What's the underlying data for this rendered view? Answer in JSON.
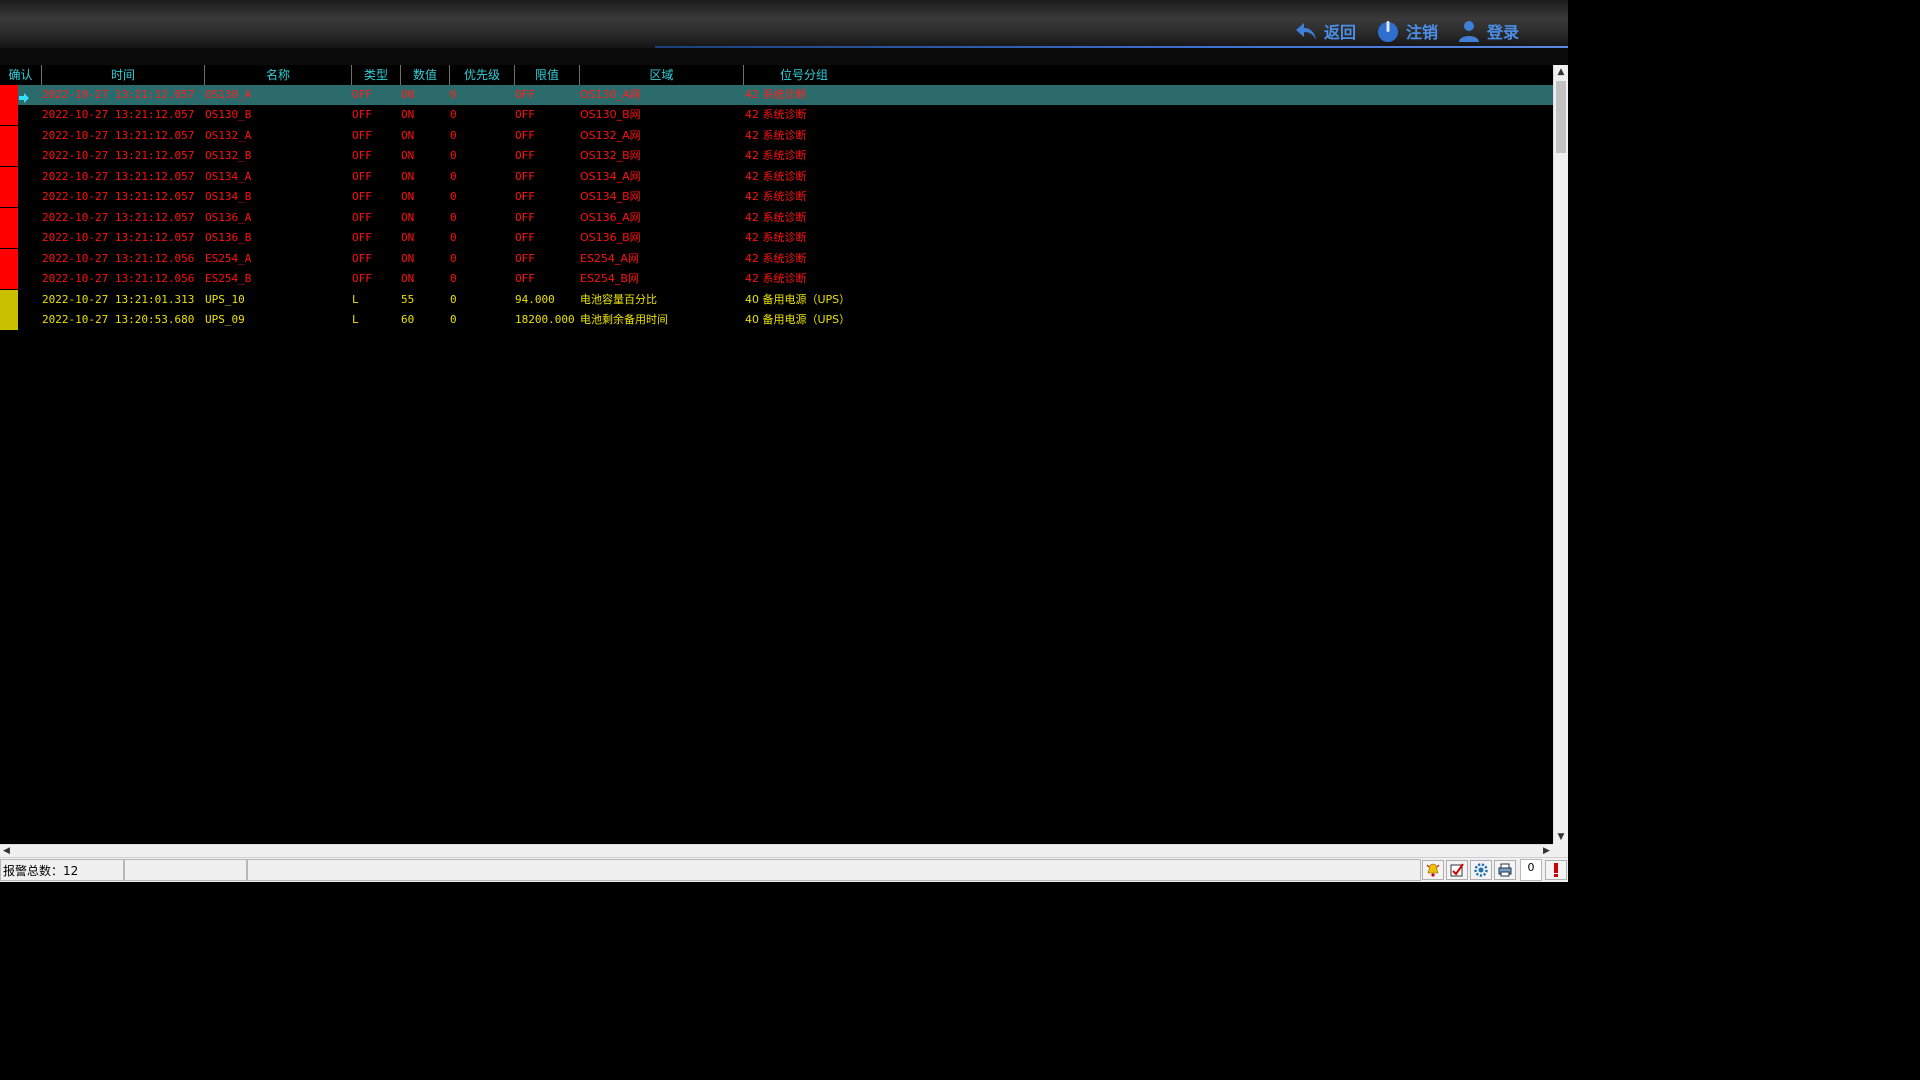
{
  "header": {
    "back_label": "返回",
    "logout_label": "注销",
    "login_label": "登录"
  },
  "table": {
    "columns": [
      "确认",
      "时间",
      "名称",
      "类型",
      "数值",
      "优先级",
      "限值",
      "区域",
      "位号分组"
    ],
    "rows": [
      {
        "color": "red",
        "selected": true,
        "time": "2022-10-27 13:21:12.057",
        "name": "OS130_A",
        "type": "OFF",
        "value": "ON",
        "priority": "0",
        "limit": "OFF",
        "area": "OS130_A网",
        "group": "42 系统诊断"
      },
      {
        "color": "red",
        "selected": false,
        "time": "2022-10-27 13:21:12.057",
        "name": "OS130_B",
        "type": "OFF",
        "value": "ON",
        "priority": "0",
        "limit": "OFF",
        "area": "OS130_B网",
        "group": "42 系统诊断"
      },
      {
        "color": "red",
        "selected": false,
        "time": "2022-10-27 13:21:12.057",
        "name": "OS132_A",
        "type": "OFF",
        "value": "ON",
        "priority": "0",
        "limit": "OFF",
        "area": "OS132_A网",
        "group": "42 系统诊断"
      },
      {
        "color": "red",
        "selected": false,
        "time": "2022-10-27 13:21:12.057",
        "name": "OS132_B",
        "type": "OFF",
        "value": "ON",
        "priority": "0",
        "limit": "OFF",
        "area": "OS132_B网",
        "group": "42 系统诊断"
      },
      {
        "color": "red",
        "selected": false,
        "time": "2022-10-27 13:21:12.057",
        "name": "OS134_A",
        "type": "OFF",
        "value": "ON",
        "priority": "0",
        "limit": "OFF",
        "area": "OS134_A网",
        "group": "42 系统诊断"
      },
      {
        "color": "red",
        "selected": false,
        "time": "2022-10-27 13:21:12.057",
        "name": "OS134_B",
        "type": "OFF",
        "value": "ON",
        "priority": "0",
        "limit": "OFF",
        "area": "OS134_B网",
        "group": "42 系统诊断"
      },
      {
        "color": "red",
        "selected": false,
        "time": "2022-10-27 13:21:12.057",
        "name": "OS136_A",
        "type": "OFF",
        "value": "ON",
        "priority": "0",
        "limit": "OFF",
        "area": "OS136_A网",
        "group": "42 系统诊断"
      },
      {
        "color": "red",
        "selected": false,
        "time": "2022-10-27 13:21:12.057",
        "name": "OS136_B",
        "type": "OFF",
        "value": "ON",
        "priority": "0",
        "limit": "OFF",
        "area": "OS136_B网",
        "group": "42 系统诊断"
      },
      {
        "color": "red",
        "selected": false,
        "time": "2022-10-27 13:21:12.056",
        "name": "ES254_A",
        "type": "OFF",
        "value": "ON",
        "priority": "0",
        "limit": "OFF",
        "area": "ES254_A网",
        "group": "42 系统诊断"
      },
      {
        "color": "red",
        "selected": false,
        "time": "2022-10-27 13:21:12.056",
        "name": "ES254_B",
        "type": "OFF",
        "value": "ON",
        "priority": "0",
        "limit": "OFF",
        "area": "ES254_B网",
        "group": "42 系统诊断"
      },
      {
        "color": "yellow",
        "selected": false,
        "time": "2022-10-27 13:21:01.313",
        "name": "UPS_10",
        "type": "L",
        "value": "55",
        "priority": "0",
        "limit": "94.000",
        "area": "电池容量百分比",
        "group": "40 备用电源（UPS）"
      },
      {
        "color": "yellow",
        "selected": false,
        "time": "2022-10-27 13:20:53.680",
        "name": "UPS_09",
        "type": "L",
        "value": "60",
        "priority": "0",
        "limit": "18200.000",
        "area": "电池剩余备用时间",
        "group": "40 备用电源（UPS）"
      }
    ]
  },
  "status": {
    "total_alarms": "报警总数：12",
    "count_box": "0"
  },
  "colors": {
    "alarm_red": "#ff0000",
    "alarm_yellow": "#c8c000",
    "header_text": "#2fd0d8",
    "selected_row": "#2b6b6b",
    "button_blue": "#4b8fe8"
  },
  "icons": {
    "back": "back-arrow-icon",
    "logout": "power-icon",
    "login": "user-icon",
    "selected_marker": "right-arrow-icon",
    "status_icons": [
      "bell-alarm-icon",
      "acknowledge-icon",
      "settings-gear-icon",
      "print-icon",
      "alarm-flag-icon"
    ]
  }
}
